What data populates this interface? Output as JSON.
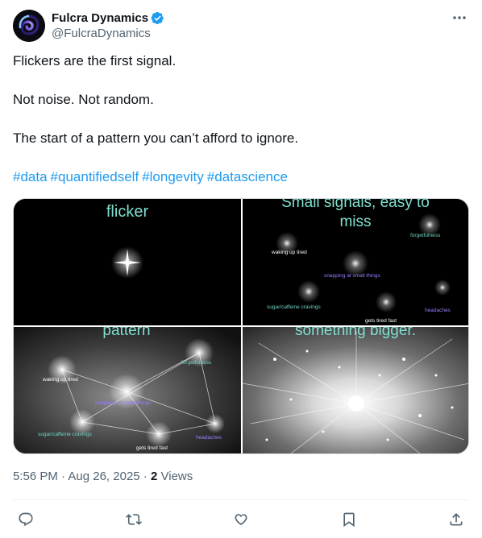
{
  "author": {
    "display_name": "Fulcra Dynamics",
    "handle": "@FulcraDynamics",
    "verified": true,
    "verified_color": "#1d9bf0"
  },
  "tweet": {
    "lines": [
      "Flickers are the first signal.",
      "Not noise. Not random.",
      "The start of a pattern you can’t afford to ignore."
    ],
    "hashtags": [
      "#data",
      "#quantifiedself",
      "#longevity",
      "#datascience"
    ],
    "hashtag_color": "#1d9bf0"
  },
  "media": {
    "panels": [
      {
        "caption": "flicker",
        "labels": []
      },
      {
        "caption_line1": "Small signals, easy to",
        "caption_line2": "miss",
        "labels": [
          "forgetfulness",
          "waking up tired",
          "snapping at small things",
          "sugar/caffeine cravings",
          "headaches",
          "gets tired fast"
        ]
      },
      {
        "caption": "pattern",
        "labels": [
          "forgetfulness",
          "waking up tired",
          "snapping at small things",
          "sugar/caffeine cravings",
          "headaches",
          "gets tired fast"
        ]
      },
      {
        "caption": "something bigger.",
        "labels": []
      }
    ]
  },
  "meta": {
    "time": "5:56 PM",
    "date": "Aug 26, 2025",
    "separator": "·",
    "views_count": "2",
    "views_label": "Views"
  },
  "actions": {
    "icons": [
      "reply-icon",
      "retweet-icon",
      "like-icon",
      "bookmark-icon",
      "share-icon"
    ]
  }
}
